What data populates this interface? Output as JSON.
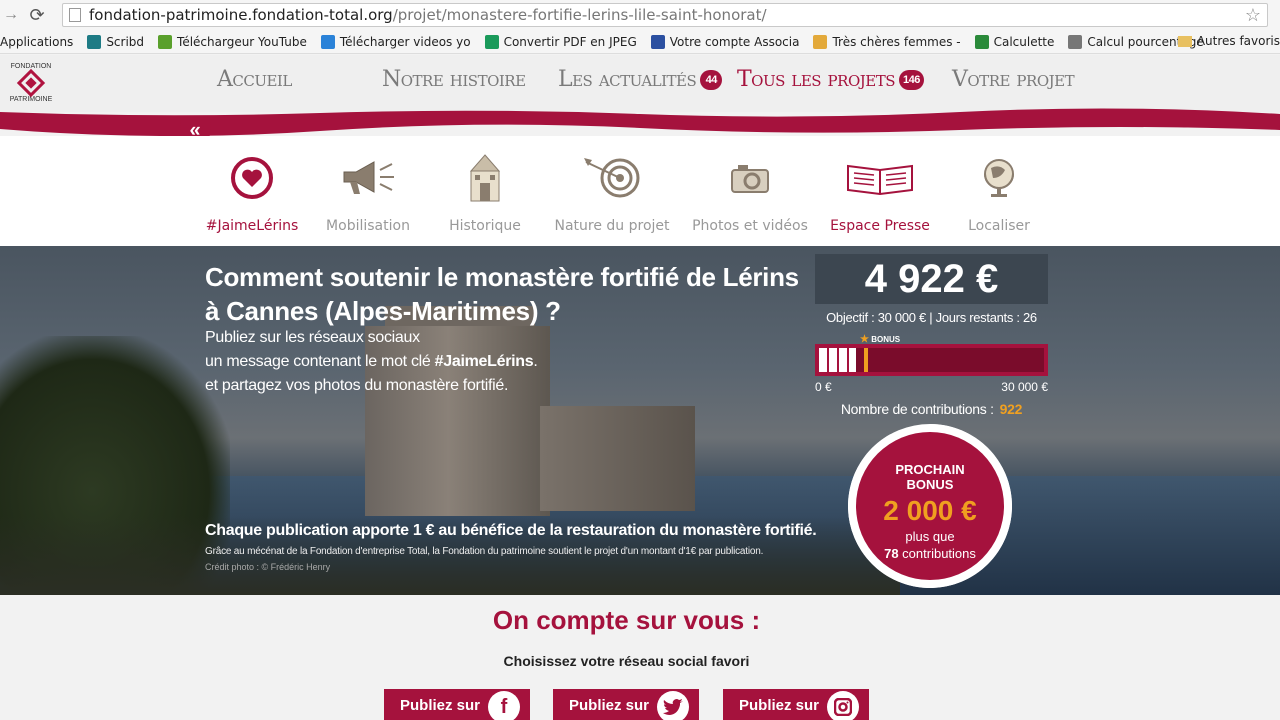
{
  "browser": {
    "url_host": "fondation-patrimoine.fondation-total.org",
    "url_path": "/projet/monastere-fortifie-lerins-lile-saint-honorat/"
  },
  "bookmarks": {
    "items": [
      {
        "label": "Applications",
        "color": "#4a7bd0"
      },
      {
        "label": "Scribd",
        "color": "#1e7b85"
      },
      {
        "label": "Téléchargeur YouTube",
        "color": "#5aa02c"
      },
      {
        "label": "Télécharger videos yo",
        "color": "#2a82d8"
      },
      {
        "label": "Convertir PDF en JPEG",
        "color": "#1a9a5a"
      },
      {
        "label": "Votre compte Associa",
        "color": "#2b4fa0"
      },
      {
        "label": "Très chères femmes -",
        "color": "#e3a93a"
      },
      {
        "label": "Calculette",
        "color": "#2a8a3a"
      },
      {
        "label": "Calcul pourcentage",
        "color": "#777777"
      }
    ],
    "more": "»",
    "other": "Autres favoris"
  },
  "logo": {
    "line1": "FONDATION",
    "line2": "PATRIMOINE"
  },
  "nav": {
    "accueil": "Accueil",
    "histoire": "Notre histoire",
    "actualites": "Les actualités",
    "actualites_count": "44",
    "projets": "Tous les projets",
    "projets_count": "146",
    "votre_projet": "Votre projet"
  },
  "back": "«",
  "subnav": {
    "jaime": "#JaimeLérins",
    "mobilisation": "Mobilisation",
    "historique": "Historique",
    "nature": "Nature du projet",
    "photos": "Photos et vidéos",
    "presse": "Espace Presse",
    "localiser": "Localiser"
  },
  "hero": {
    "title": "Comment soutenir le monastère fortifié de Lérins à Cannes (Alpes-Maritimes) ?",
    "sub1": "Publiez sur les réseaux sociaux",
    "sub2_pre": "un message contenant le mot clé ",
    "sub2_hash": "#JaimeLérins",
    "sub2_post": ".",
    "sub3": "et partagez vos photos du monastère fortifié.",
    "bottom": "Chaque publication apporte 1 € au bénéfice de la restauration du monastère fortifié.",
    "small": "Grâce au mécénat de la Fondation d'entreprise Total, la Fondation du patrimoine soutient le projet d'un montant d'1€ par publication.",
    "credit": "Crédit photo : © Frédéric Henry"
  },
  "funding": {
    "amount": "4 922 €",
    "objective": "Objectif : 30 000 € | Jours restants : 26",
    "bonus_label": "BONUS",
    "progress": 0.164,
    "bonus_mark": 0.2,
    "scale_min": "0 €",
    "scale_max": "30 000 €",
    "contrib_label": "Nombre de contributions :",
    "contrib_count": "922"
  },
  "bonus": {
    "title1": "PROCHAIN",
    "title2": "BONUS",
    "amount": "2 000 €",
    "line1": "plus que",
    "count": "78",
    "line2": " contributions",
    "ring_progress": 0.92
  },
  "cta": {
    "title": "On compte sur vous :",
    "subtitle": "Choisissez votre réseau social favori",
    "btn_facebook": "Publiez sur",
    "btn_twitter": "Publiez sur",
    "btn_instagram": "Publiez sur"
  },
  "colors": {
    "brand": "#a5123d",
    "accent": "#f0a020"
  }
}
